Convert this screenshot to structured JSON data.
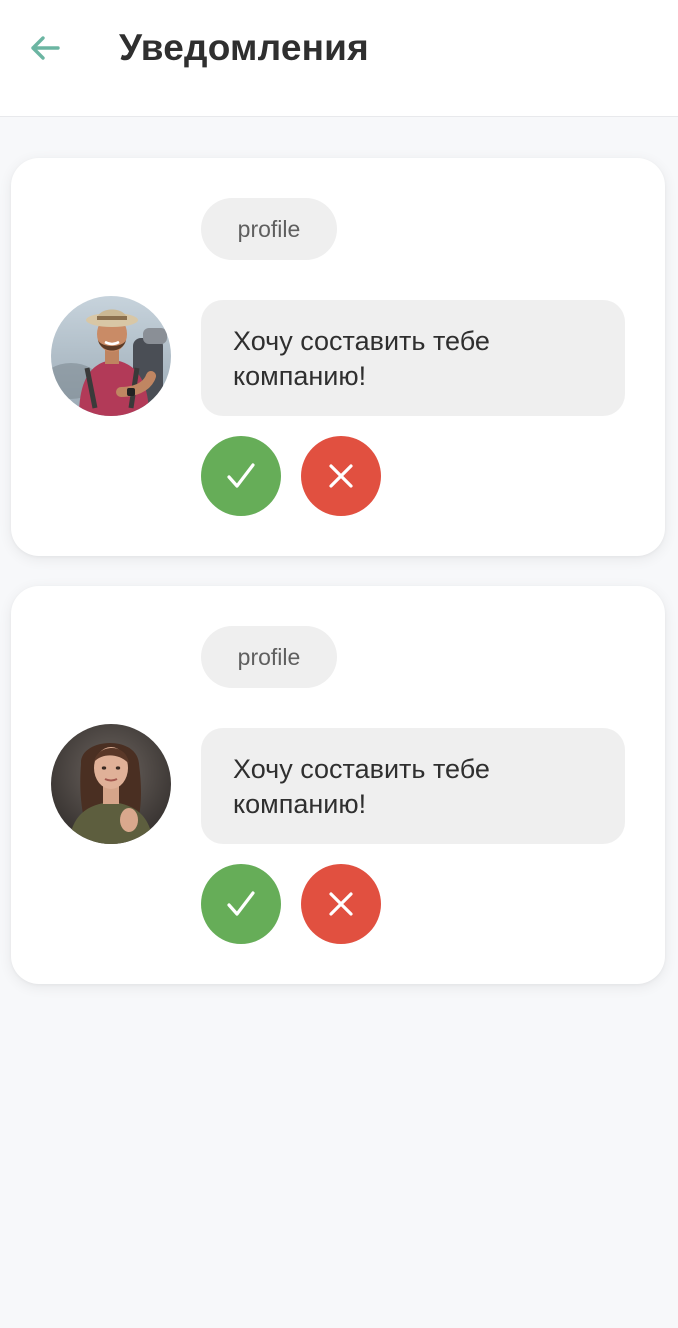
{
  "header": {
    "title": "Уведомления",
    "back_icon": "arrow-left-icon",
    "accent_color": "#6bb5a2"
  },
  "notifications": [
    {
      "tag": "profile",
      "message": "Хочу составить тебе компанию!",
      "avatar": "avatar-man-hiker",
      "accept_icon": "check-icon",
      "decline_icon": "close-icon"
    },
    {
      "tag": "profile",
      "message": "Хочу составить тебе компанию!",
      "avatar": "avatar-woman",
      "accept_icon": "check-icon",
      "decline_icon": "close-icon"
    }
  ],
  "colors": {
    "accept": "#66ad58",
    "decline": "#e15040",
    "bubble": "#efefef",
    "background": "#f7f8fa"
  }
}
